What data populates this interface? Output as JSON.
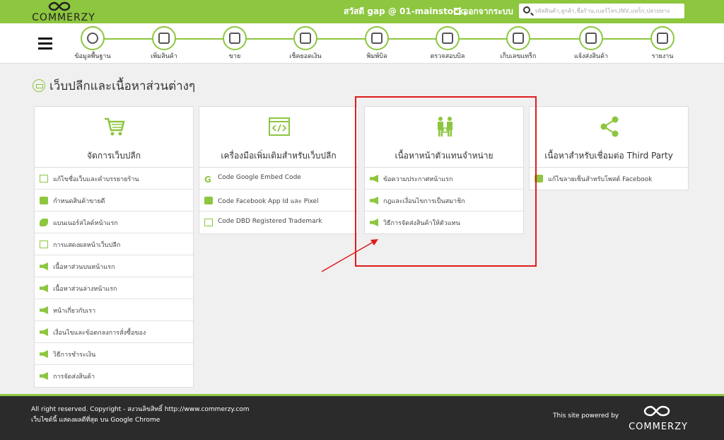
{
  "brand": {
    "name": "COMMERZY"
  },
  "topbar": {
    "greeting": "สวัสดี gap @ 01-mainstock,",
    "logout_label": "ออกจากระบบ",
    "search_placeholder": "รหัสสินค้า,ลูกค้า,ชื่อร้าน,เบอร์โทร,INV,แทร็ก,ปลายทาง"
  },
  "nav": {
    "items": [
      {
        "label": "ข้อมูลพื้นฐาน",
        "icon": "database-icon"
      },
      {
        "label": "เพิ่มสินค้า",
        "icon": "box-icon"
      },
      {
        "label": "ขาย",
        "icon": "cash-register-icon"
      },
      {
        "label": "เช็คยอดเงิน",
        "icon": "check-money-icon"
      },
      {
        "label": "พิมพ์บิล",
        "icon": "printer-icon"
      },
      {
        "label": "ตรวจสอบบิล",
        "icon": "barcode-scan-icon"
      },
      {
        "label": "เก็บเลขแทร็ก",
        "icon": "scanner-icon"
      },
      {
        "label": "แจ้งส่งสินค้า",
        "icon": "truck-icon"
      },
      {
        "label": "รายงาน",
        "icon": "report-icon"
      }
    ]
  },
  "page": {
    "title": "เว็บปลีกและเนื้อหาส่วนต่างๆ"
  },
  "cards": [
    {
      "title": "จัดการเว็บปลีก",
      "icon": "shopping-cart-icon",
      "items": [
        {
          "label": "แก้ไขชื่อเว็บและคำบรรยายร้าน",
          "icon": "document-icon"
        },
        {
          "label": "กำหนดสินค้าขายดี",
          "icon": "box-icon"
        },
        {
          "label": "แบนเนอร์สไลด์หน้าแรก",
          "icon": "banner-icon"
        },
        {
          "label": "การแสดงผลหน้าเว็บปลีก",
          "icon": "document-icon"
        },
        {
          "label": "เนื้อหาส่วนบนหน้าแรก",
          "icon": "megaphone-icon"
        },
        {
          "label": "เนื้อหาส่วนล่างหน้าแรก",
          "icon": "megaphone-icon"
        },
        {
          "label": "หน้าเกี่ยวกับเรา",
          "icon": "megaphone-icon"
        },
        {
          "label": "เงื่อนไขและข้อตกลงการสั่งซื้อของ",
          "icon": "megaphone-icon"
        },
        {
          "label": "วิธีการชำระเงิน",
          "icon": "megaphone-icon"
        },
        {
          "label": "การจัดส่งสินค้า",
          "icon": "megaphone-icon"
        }
      ]
    },
    {
      "title": "เครื่องมือเพิ่มเติมสำหรับเว็บปลีก",
      "icon": "code-window-icon",
      "items": [
        {
          "label": "Code Google Embed Code",
          "icon": "google-icon"
        },
        {
          "label": "Code Facebook App Id และ Pixel",
          "icon": "facebook-icon"
        },
        {
          "label": "Code DBD Registered Trademark",
          "icon": "document-icon"
        }
      ]
    },
    {
      "title": "เนื้อหาหน้าตัวแทนจำหน่าย",
      "icon": "agent-people-icon",
      "items": [
        {
          "label": "ข้อความประกาศหน้าแรก",
          "icon": "megaphone-icon"
        },
        {
          "label": "กฎและเงื่อนไขการเป็นสมาชิก",
          "icon": "megaphone-icon"
        },
        {
          "label": "วิธีการจัดส่งสินค้าให้ตัวแทน",
          "icon": "megaphone-icon"
        }
      ]
    },
    {
      "title": "เนื้อหาสำหรับเชื่อมต่อ Third Party",
      "icon": "share-icon",
      "items": [
        {
          "label": "แก้ไขลายเซ็นสำหรับโพสต์ Facebook",
          "icon": "facebook-icon"
        }
      ]
    }
  ],
  "footer": {
    "copyright": "All right reserved. Copyright - สงวนลิขสิทธิ์ http://www.commerzy.com",
    "browser_note": "เว็บไซต์นี้ แสดงผลดีที่สุด บน Google Chrome",
    "powered_by": "This site powered by"
  },
  "colors": {
    "brand_green": "#8dc63f",
    "footer_bg": "#2b2b2b",
    "annotation_red": "#e01b1b"
  }
}
